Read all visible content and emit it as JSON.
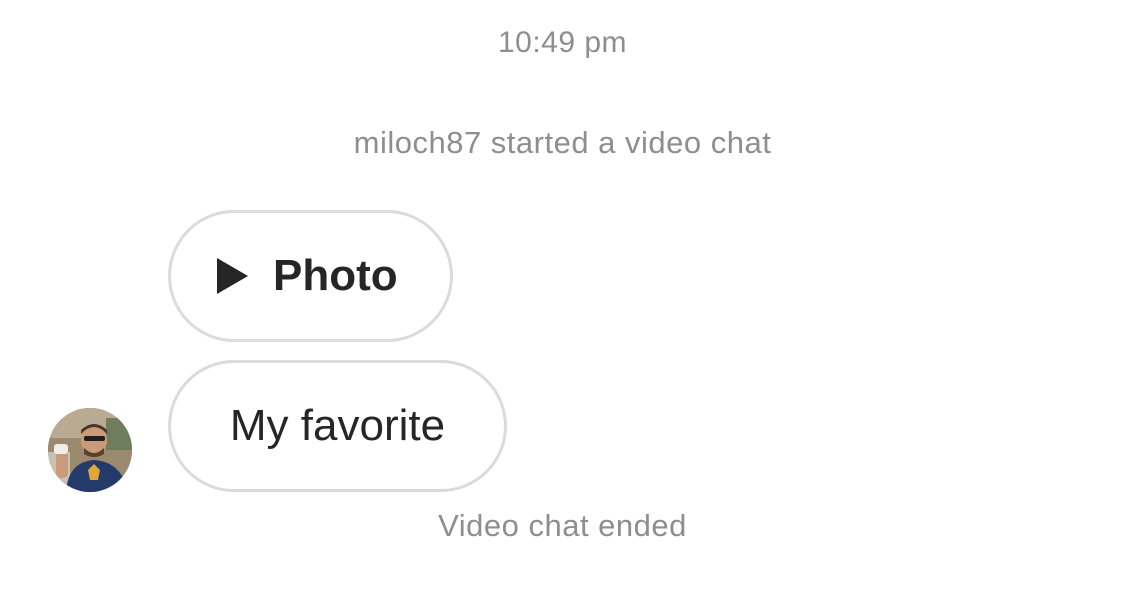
{
  "thread": {
    "timestamp": "10:49 pm",
    "system_start": "miloch87 started a video chat",
    "system_end": "Video chat ended",
    "messages": [
      {
        "type": "media",
        "icon": "play-icon",
        "label": "Photo"
      },
      {
        "type": "text",
        "label": "My favorite"
      }
    ]
  },
  "colors": {
    "meta_text": "#8e8e8e",
    "bubble_border": "#dbdbdb",
    "message_text": "#262626",
    "background": "#ffffff"
  }
}
